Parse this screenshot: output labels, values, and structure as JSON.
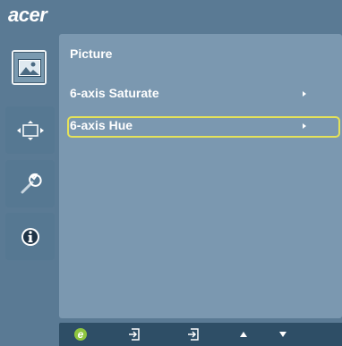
{
  "brand": {
    "logo": "acer"
  },
  "sidebar": {
    "items": [
      {
        "name": "picture",
        "icon": "picture-icon",
        "active": true
      },
      {
        "name": "screen-position",
        "icon": "screen-position-icon",
        "active": false
      },
      {
        "name": "settings",
        "icon": "wrench-icon",
        "active": false
      },
      {
        "name": "information",
        "icon": "info-icon",
        "active": false
      }
    ]
  },
  "panel": {
    "title": "Picture",
    "items": [
      {
        "label": "6-axis Saturate",
        "selected": false
      },
      {
        "label": "6-axis Hue",
        "selected": true
      }
    ]
  },
  "bottom_bar": {
    "buttons": [
      {
        "icon": "empowering-icon"
      },
      {
        "icon": "input-icon"
      },
      {
        "icon": "input-icon"
      },
      {
        "icon": "up-arrow-icon"
      },
      {
        "icon": "down-arrow-icon"
      }
    ]
  },
  "colors": {
    "background": "#5a7a94",
    "panel": "#7b98b0",
    "selection_border": "#e4e25a",
    "bottom_bar": "#2e4e66"
  }
}
